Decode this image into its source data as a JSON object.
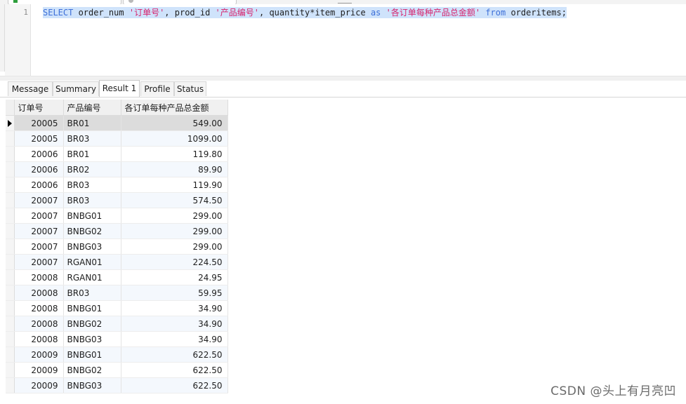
{
  "editor": {
    "line_number": "1",
    "tokens": {
      "t1": "SELECT",
      "t2": " order_num ",
      "t3": "'订单号'",
      "t4": ", prod_id ",
      "t5": "'产品编号'",
      "t6": ", quantity*item_price ",
      "t7": "as",
      "t8": " ",
      "t9": "'各订单每种产品总金额'",
      "t10": " ",
      "t11": "from",
      "t12": " orderitems;"
    }
  },
  "tabs": [
    "Message",
    "Summary",
    "Result 1",
    "Profile",
    "Status"
  ],
  "active_tab": "Result 1",
  "grid": {
    "columns": [
      "订单号",
      "产品编号",
      "各订单每种产品总金额"
    ],
    "rows": [
      [
        "20005",
        "BR01",
        "549.00"
      ],
      [
        "20005",
        "BR03",
        "1099.00"
      ],
      [
        "20006",
        "BR01",
        "119.80"
      ],
      [
        "20006",
        "BR02",
        "89.90"
      ],
      [
        "20006",
        "BR03",
        "119.90"
      ],
      [
        "20007",
        "BR03",
        "574.50"
      ],
      [
        "20007",
        "BNBG01",
        "299.00"
      ],
      [
        "20007",
        "BNBG02",
        "299.00"
      ],
      [
        "20007",
        "BNBG03",
        "299.00"
      ],
      [
        "20007",
        "RGAN01",
        "224.50"
      ],
      [
        "20008",
        "RGAN01",
        "24.95"
      ],
      [
        "20008",
        "BR03",
        "59.95"
      ],
      [
        "20008",
        "BNBG01",
        "34.90"
      ],
      [
        "20008",
        "BNBG02",
        "34.90"
      ],
      [
        "20008",
        "BNBG03",
        "34.90"
      ],
      [
        "20009",
        "BNBG01",
        "622.50"
      ],
      [
        "20009",
        "BNBG02",
        "622.50"
      ],
      [
        "20009",
        "BNBG03",
        "622.50"
      ]
    ],
    "selected_row": 0
  },
  "watermark": "CSDN @头上有月亮凹",
  "colors": {
    "keyword": "#3c6fd8",
    "string": "#d6246e",
    "selection": "#cfe3fb"
  }
}
